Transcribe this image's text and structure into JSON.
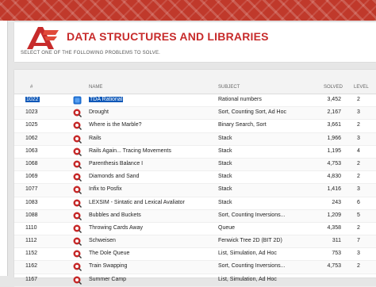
{
  "page": {
    "title": "DATA STRUCTURES AND LIBRARIES",
    "subtitle": "SELECT ONE OF THE FOLLOWING PROBLEMS TO SOLVE."
  },
  "table": {
    "headers": {
      "id": "#",
      "name": "NAME",
      "subject": "SUBJECT",
      "solved": "SOLVED",
      "level": "LEVEL"
    },
    "rows": [
      {
        "id": "1022",
        "name": "TDA Rational",
        "subject": "Rational numbers",
        "solved": "3,452",
        "level": "2",
        "status": "solved"
      },
      {
        "id": "1023",
        "name": "Drought",
        "subject": "Sort, Counting Sort, Ad Hoc",
        "solved": "2,167",
        "level": "3",
        "status": "unsolved"
      },
      {
        "id": "1025",
        "name": "Where is the Marble?",
        "subject": "Binary Search, Sort",
        "solved": "3,661",
        "level": "2",
        "status": "unsolved"
      },
      {
        "id": "1062",
        "name": "Rails",
        "subject": "Stack",
        "solved": "1,966",
        "level": "3",
        "status": "unsolved"
      },
      {
        "id": "1063",
        "name": "Rails Again... Tracing Movements",
        "subject": "Stack",
        "solved": "1,195",
        "level": "4",
        "status": "unsolved"
      },
      {
        "id": "1068",
        "name": "Parenthesis Balance I",
        "subject": "Stack",
        "solved": "4,753",
        "level": "2",
        "status": "unsolved"
      },
      {
        "id": "1069",
        "name": "Diamonds and Sand",
        "subject": "Stack",
        "solved": "4,830",
        "level": "2",
        "status": "unsolved"
      },
      {
        "id": "1077",
        "name": "Infix to Posfix",
        "subject": "Stack",
        "solved": "1,416",
        "level": "3",
        "status": "unsolved"
      },
      {
        "id": "1083",
        "name": "LEXSIM - Sintatic and Lexical Avaliator",
        "subject": "Stack",
        "solved": "243",
        "level": "6",
        "status": "unsolved"
      },
      {
        "id": "1088",
        "name": "Bubbles and Buckets",
        "subject": "Sort, Counting Inversions...",
        "solved": "1,209",
        "level": "5",
        "status": "unsolved"
      },
      {
        "id": "1110",
        "name": "Throwing Cards Away",
        "subject": "Queue",
        "solved": "4,358",
        "level": "2",
        "status": "unsolved"
      },
      {
        "id": "1112",
        "name": "Schweisen",
        "subject": "Fenwick Tree 2D (BIT 2D)",
        "solved": "311",
        "level": "7",
        "status": "unsolved"
      },
      {
        "id": "1152",
        "name": "The Dole Queue",
        "subject": "List, Simulation, Ad Hoc",
        "solved": "753",
        "level": "3",
        "status": "unsolved"
      },
      {
        "id": "1162",
        "name": "Train Swapping",
        "subject": "Sort, Counting Inversions...",
        "solved": "4,753",
        "level": "2",
        "status": "unsolved"
      },
      {
        "id": "1167",
        "name": "Summer Camp",
        "subject": "List, Simulation, Ad Hoc",
        "solved": "",
        "level": "",
        "status": "unsolved"
      }
    ]
  },
  "colors": {
    "brand": "#c72b2b",
    "selection": "#0e58b8",
    "solved_icon": "#1f6fd1",
    "unsolved_icon": "#c62828"
  }
}
